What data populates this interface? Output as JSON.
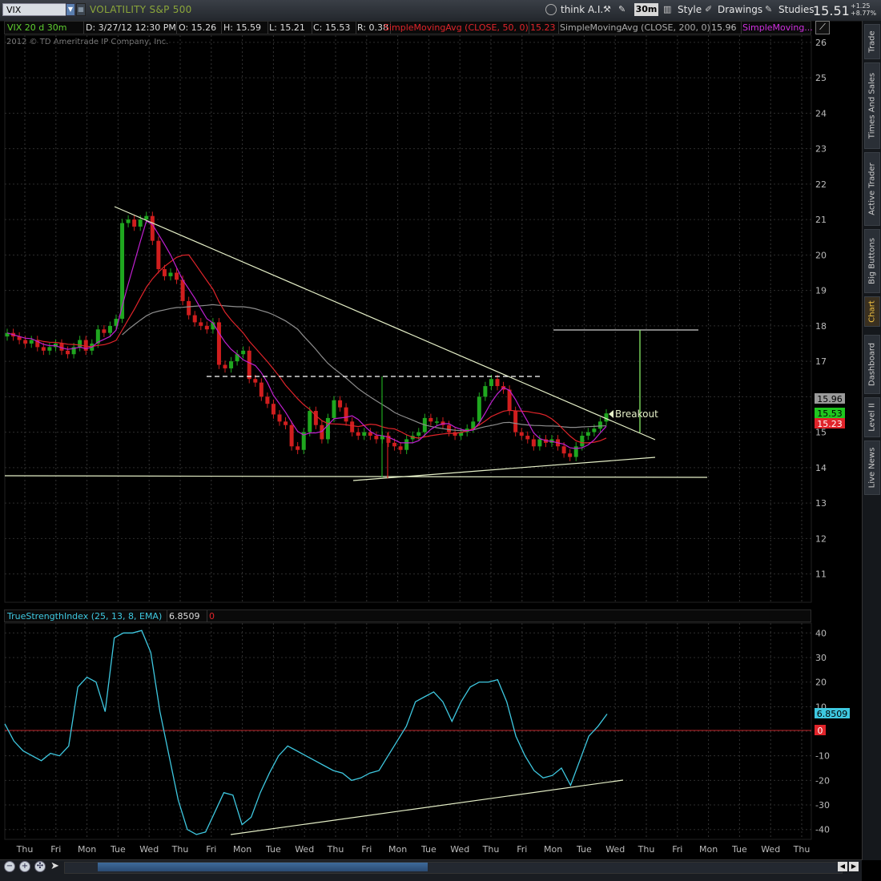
{
  "toolbar": {
    "symbol": "VIX",
    "description": "VOLATILITY S&P 500",
    "think_ai": "think A.I.",
    "interval": "30m",
    "style": "Style",
    "drawings": "Drawings",
    "studies": "Studies",
    "last_price": "15.51",
    "change_abs": "+1.25",
    "change_pct": "+8.77%"
  },
  "infobar": {
    "symbol": "VIX 20 d 30m",
    "date": "D: 3/27/12 12:30 PM",
    "open": "O: 15.26",
    "high": "H: 15.59",
    "low": "L: 15.21",
    "close": "C: 15.53",
    "range": "R: 0.38",
    "sma50_label": "SimpleMovingAvg (CLOSE, 50, 0)",
    "sma50_value": "15.23",
    "sma200_label": "SimpleMovingAvg (CLOSE, 200, 0)",
    "sma200_value": "15.96",
    "sma3_label": "SimpleMoving...",
    "copyright": "2012 © TD Ameritrade IP Company, Inc."
  },
  "indicator": {
    "label": "TrueStrengthIndex (25, 13, 8, EMA)",
    "value": "6.8509",
    "zero": "0"
  },
  "side_tabs": [
    "Trade",
    "Times And Sales",
    "Active Trader",
    "Big Buttons",
    "Chart",
    "Dashboard",
    "Level II",
    "Live News"
  ],
  "active_tab": "Chart",
  "colors": {
    "sma50": "#e0242a",
    "sma200": "#8e8e8e",
    "sma_short": "#c020d0",
    "up_candle": "#1fa71f",
    "down_candle": "#d01e1e",
    "tsi": "#3ec8e0",
    "trendline": "#e6f0c8",
    "target": "#88ee66"
  },
  "chart_data": [
    {
      "type": "candlestick",
      "title": "VIX 20 d 30m",
      "y_ticks": [
        11,
        12,
        13,
        14,
        15,
        16,
        17,
        18,
        19,
        20,
        21,
        22,
        23,
        24,
        25,
        26
      ],
      "ylim": [
        10.2,
        26.2
      ],
      "x_ticks": [
        "Thu",
        "Fri",
        "Mon",
        "Tue",
        "Wed",
        "Thu",
        "Fri",
        "Mon",
        "Tue",
        "Wed",
        "Thu",
        "Fri",
        "Mon",
        "Tue",
        "Wed",
        "Thu",
        "Fri",
        "Mon",
        "Tue",
        "Wed",
        "Thu",
        "Fri",
        "Mon",
        "Tue",
        "Wed",
        "Thu"
      ],
      "price_badges": {
        "sma200": "15.96",
        "last": "15.53",
        "sma50": "15.23"
      },
      "annotation": "Breakout",
      "close_path": [
        17.8,
        17.7,
        17.6,
        17.5,
        17.6,
        17.4,
        17.3,
        17.4,
        17.5,
        17.3,
        17.2,
        17.4,
        17.6,
        17.3,
        17.5,
        17.9,
        17.8,
        18.0,
        18.2,
        20.9,
        21.0,
        20.8,
        21.0,
        21.1,
        20.4,
        19.6,
        19.4,
        19.5,
        19.3,
        18.7,
        18.3,
        18.1,
        18.0,
        17.9,
        18.1,
        16.9,
        16.8,
        17.0,
        17.2,
        17.3,
        16.5,
        16.4,
        16.0,
        15.8,
        15.5,
        15.3,
        15.2,
        14.6,
        14.5,
        15.0,
        15.6,
        15.2,
        14.8,
        15.4,
        15.9,
        15.7,
        15.3,
        15.0,
        14.9,
        15.0,
        14.9,
        14.8,
        14.9,
        14.7,
        14.6,
        14.5,
        14.8,
        14.9,
        15.0,
        15.4,
        15.3,
        15.3,
        15.2,
        15.0,
        14.9,
        15.0,
        15.1,
        15.3,
        16.0,
        16.3,
        16.5,
        16.3,
        16.2,
        15.6,
        15.0,
        14.9,
        14.8,
        14.6,
        14.8,
        14.7,
        14.8,
        14.6,
        14.4,
        14.3,
        14.6,
        14.9,
        15.0,
        15.1,
        15.3,
        15.53
      ]
    },
    {
      "type": "line",
      "title": "TrueStrengthIndex (25, 13, 8, EMA)",
      "y_ticks": [
        40,
        30,
        20,
        10,
        0,
        -10,
        -20,
        -30,
        -40
      ],
      "ylim": [
        -44,
        44
      ],
      "values": [
        3,
        -4,
        -8,
        -10,
        -12,
        -9,
        -10,
        -6,
        18,
        22,
        20,
        8,
        38,
        40,
        40,
        41,
        32,
        8,
        -10,
        -28,
        -40,
        -42,
        -41,
        -33,
        -25,
        -26,
        -38,
        -35,
        -25,
        -17,
        -10,
        -6,
        -8,
        -10,
        -12,
        -14,
        -16,
        -17,
        -20,
        -19,
        -17,
        -16,
        -10,
        -4,
        2,
        12,
        14,
        16,
        12,
        4,
        12,
        18,
        20,
        20,
        21,
        12,
        -2,
        -10,
        -16,
        -19,
        -18,
        -15,
        -22,
        -12,
        -2,
        2,
        7
      ]
    }
  ]
}
